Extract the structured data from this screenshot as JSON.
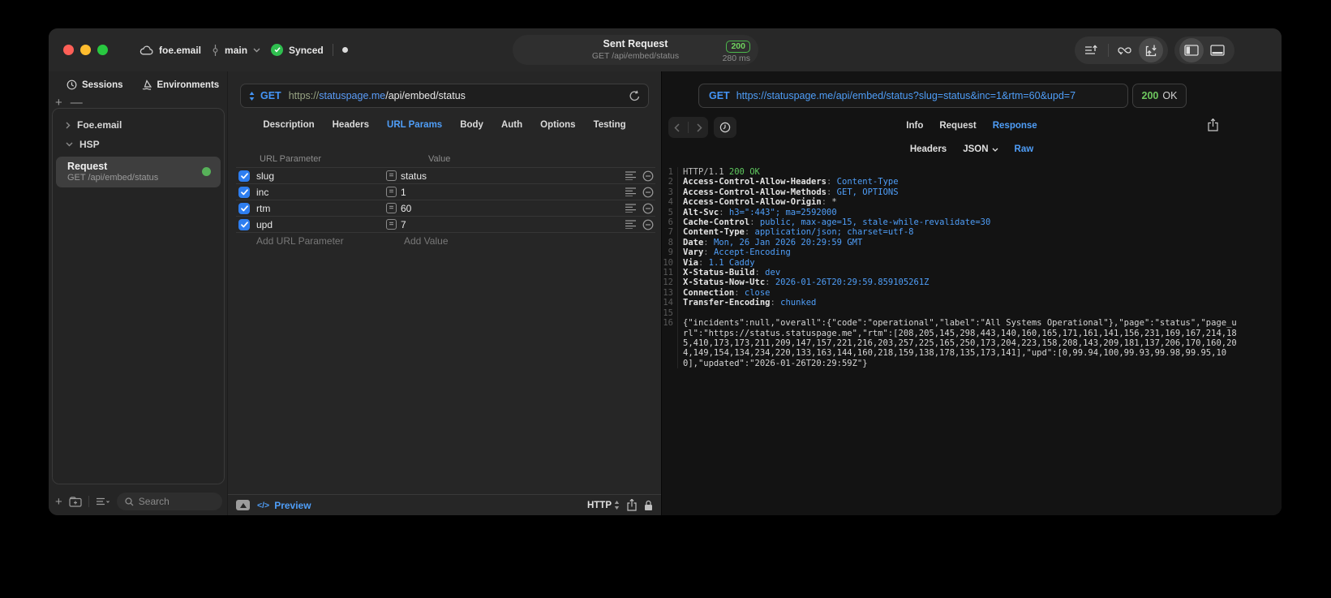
{
  "titlebar": {
    "project": "foe.email",
    "branch": "main",
    "sync_label": "Synced",
    "request_title": "Sent Request",
    "request_subtitle": "GET /api/embed/status",
    "status_code": "200",
    "duration": "280 ms"
  },
  "sidebar": {
    "tabs": [
      {
        "label": "Sessions"
      },
      {
        "label": "Environments"
      }
    ],
    "groups": [
      {
        "label": "Foe.email",
        "expanded": false
      },
      {
        "label": "HSP",
        "expanded": true
      }
    ],
    "request_item": {
      "title": "Request",
      "subtitle": "GET /api/embed/status"
    },
    "search_placeholder": "Search"
  },
  "request_editor": {
    "method": "GET",
    "url": {
      "scheme": "https://",
      "host": "statuspage.me",
      "path": "/api/embed/status"
    },
    "tabs": [
      "Description",
      "Headers",
      "URL Params",
      "Body",
      "Auth",
      "Options",
      "Testing"
    ],
    "active_tab": "URL Params",
    "params": {
      "col_name": "URL Parameter",
      "col_value": "Value",
      "equals_glyph": "=",
      "rows": [
        {
          "enabled": true,
          "name": "slug",
          "value": "status"
        },
        {
          "enabled": true,
          "name": "inc",
          "value": "1"
        },
        {
          "enabled": true,
          "name": "rtm",
          "value": "60"
        },
        {
          "enabled": true,
          "name": "upd",
          "value": "7"
        }
      ],
      "add_name": "Add URL Parameter",
      "add_value": "Add Value"
    },
    "footer": {
      "preview_icon": "</>",
      "preview": "Preview",
      "protocol": "HTTP"
    }
  },
  "response_viewer": {
    "method": "GET",
    "url": "https://statuspage.me/api/embed/status?slug=status&inc=1&rtm=60&upd=7",
    "status_code": "200",
    "status_text": "OK",
    "tabs": [
      "Info",
      "Request",
      "Response"
    ],
    "active_tab": "Response",
    "subtabs": [
      "Headers",
      "JSON",
      "Raw"
    ],
    "active_subtab": "Raw",
    "raw": {
      "status_line": {
        "protocol": "HTTP/1.1",
        "status": "200 OK"
      },
      "headers": [
        {
          "name": "Access-Control-Allow-Headers",
          "value": "Content-Type"
        },
        {
          "name": "Access-Control-Allow-Methods",
          "value": "GET, OPTIONS"
        },
        {
          "name": "Access-Control-Allow-Origin",
          "value": "*",
          "plain": true
        },
        {
          "name": "Alt-Svc",
          "value": "h3=\":443\"; ma=2592000"
        },
        {
          "name": "Cache-Control",
          "value": "public, max-age=15, stale-while-revalidate=30"
        },
        {
          "name": "Content-Type",
          "value": "application/json; charset=utf-8"
        },
        {
          "name": "Date",
          "value": "Mon, 26 Jan 2026 20:29:59 GMT"
        },
        {
          "name": "Vary",
          "value": "Accept-Encoding"
        },
        {
          "name": "Via",
          "value": "1.1 Caddy"
        },
        {
          "name": "X-Status-Build",
          "value": "dev"
        },
        {
          "name": "X-Status-Now-Utc",
          "value": "2026-01-26T20:29:59.859105261Z"
        },
        {
          "name": "Connection",
          "value": "close"
        },
        {
          "name": "Transfer-Encoding",
          "value": "chunked"
        }
      ],
      "body": "{\"incidents\":null,\"overall\":{\"code\":\"operational\",\"label\":\"All Systems Operational\"},\"page\":\"status\",\"page_url\":\"https://status.statuspage.me\",\"rtm\":[208,205,145,298,443,140,160,165,171,161,141,156,231,169,167,214,185,410,173,173,211,209,147,157,221,216,203,257,225,165,250,173,204,223,158,208,143,209,181,137,206,170,160,204,149,154,134,234,220,133,163,144,160,218,159,138,178,135,173,141],\"upd\":[0,99.94,100,99.93,99.98,99.95,100],\"updated\":\"2026-01-26T20:29:59Z\"}"
    }
  },
  "colors": {
    "accent_blue": "#4f9ef8",
    "status_green": "#5ec75e",
    "checkbox_blue": "#2e7ef0"
  }
}
